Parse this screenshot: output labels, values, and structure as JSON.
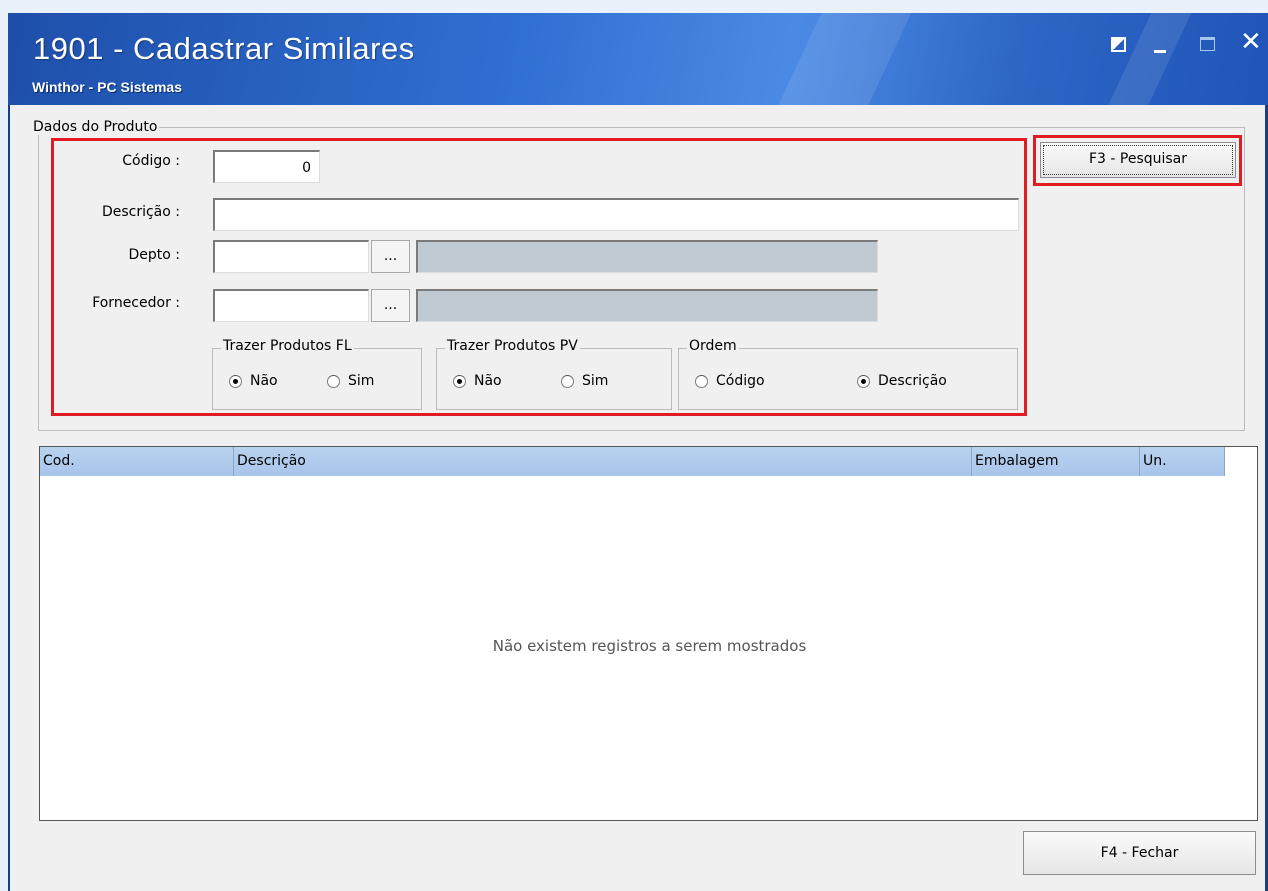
{
  "window": {
    "title": "1901 - Cadastrar Similares",
    "subtitle": "Winthor - PC Sistemas",
    "close_glyph": "✕"
  },
  "dados_produto": {
    "legend": "Dados do Produto",
    "codigo_label": "Código :",
    "codigo_value": "0",
    "descricao_label": "Descrição :",
    "descricao_value": "",
    "depto_label": "Depto :",
    "depto_value": "",
    "depto_desc": "",
    "fornecedor_label": "Fornecedor :",
    "fornecedor_value": "",
    "fornecedor_desc": "",
    "lookup_label": "..."
  },
  "filters": {
    "fl": {
      "caption": "Trazer Produtos FL",
      "options": [
        "Não",
        "Sim"
      ],
      "selected": "Não"
    },
    "pv": {
      "caption": "Trazer Produtos PV",
      "options": [
        "Não",
        "Sim"
      ],
      "selected": "Não"
    },
    "ordem": {
      "caption": "Ordem",
      "options": [
        "Código",
        "Descrição"
      ],
      "selected": "Descrição"
    }
  },
  "buttons": {
    "pesquisar": "F3 - Pesquisar",
    "fechar": "F4 - Fechar"
  },
  "grid": {
    "columns": [
      "Cod.",
      "Descrição",
      "Embalagem",
      "Un."
    ],
    "rows": [],
    "empty_message": "Não existem registros a serem mostrados"
  },
  "colors": {
    "highlight": "#e11b22",
    "title_bar": "#2f6fd1",
    "grid_header": "#b9d2ef"
  }
}
